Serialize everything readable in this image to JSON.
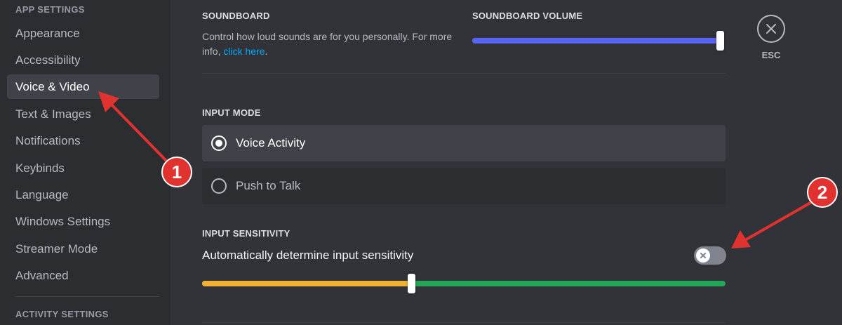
{
  "sidebar": {
    "app_settings_header": "APP SETTINGS",
    "items": [
      {
        "label": "Appearance"
      },
      {
        "label": "Accessibility"
      },
      {
        "label": "Voice & Video"
      },
      {
        "label": "Text & Images"
      },
      {
        "label": "Notifications"
      },
      {
        "label": "Keybinds"
      },
      {
        "label": "Language"
      },
      {
        "label": "Windows Settings"
      },
      {
        "label": "Streamer Mode"
      },
      {
        "label": "Advanced"
      }
    ],
    "active_item": "Voice & Video",
    "activity_settings_header": "ACTIVITY SETTINGS"
  },
  "soundboard": {
    "header": "SOUNDBOARD",
    "description": "Control how loud sounds are for you personally. For more info,",
    "link_text": "click here",
    "description_end": ".",
    "volume_label": "SOUNDBOARD VOLUME",
    "volume_percent": 100,
    "accent_color": "#5865f2"
  },
  "close_button": {
    "icon": "close-icon",
    "label": "ESC"
  },
  "input_mode": {
    "header": "INPUT MODE",
    "options": [
      {
        "label": "Voice Activity",
        "selected": true
      },
      {
        "label": "Push to Talk",
        "selected": false
      }
    ]
  },
  "input_sensitivity": {
    "header": "INPUT SENSITIVITY",
    "auto_label": "Automatically determine input sensitivity",
    "auto_enabled": false,
    "threshold_fraction": 0.4,
    "low_color": "#f0b232",
    "high_color": "#23a55a"
  },
  "annotations": [
    {
      "number": "1",
      "color": "#e0332f"
    },
    {
      "number": "2",
      "color": "#e0332f"
    }
  ]
}
